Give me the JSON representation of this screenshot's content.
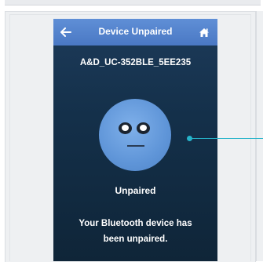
{
  "header": {
    "title": "Device Unpaired",
    "back_icon": "arrow-left-icon",
    "home_icon": "home-icon"
  },
  "device": {
    "name": "A&D_UC-352BLE_5EE235"
  },
  "status": {
    "label": "Unpaired",
    "message": "Your Bluetooth device has been unpaired."
  },
  "colors": {
    "header": "#4a78c4",
    "screen_background": "#14304a",
    "face": "#6fa3e4",
    "callout": "#26b3c9"
  }
}
